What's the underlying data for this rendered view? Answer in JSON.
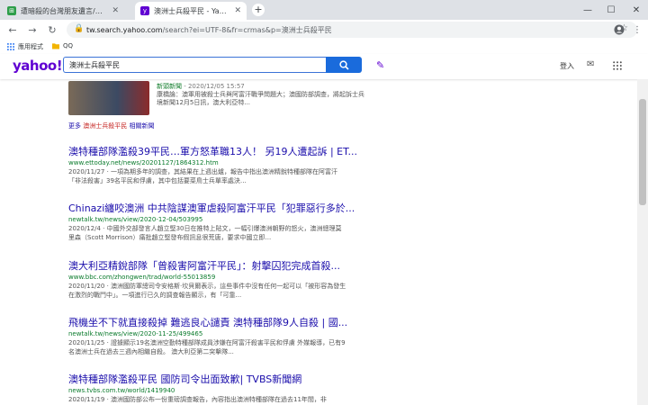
{
  "browser": {
    "tabs": [
      {
        "title": "遭暗殺的台灣朋友遺言/澳大利亞...",
        "active": false
      },
      {
        "title": "澳洲士兵殺平民 - Yahoo奇摩 搜...",
        "active": true
      }
    ],
    "new_tab": "+",
    "window_controls": [
      "—",
      "☐",
      "✕"
    ],
    "url_host": "tw.search.yahoo.com",
    "url_path": "/search?ei=UTF-8&fr=crmas&p=澳洲士兵殺平民",
    "bookmarks": [
      "應用程式",
      "QQ"
    ]
  },
  "header": {
    "logo": "yahoo!",
    "query": "澳洲士兵殺平民",
    "login": "登入"
  },
  "news": {
    "source": "新頭新聞",
    "date": " - 2020/12/05 15:57",
    "snippet1": "康橋論：澳軍用被殺士兵與阿富汗戰爭問題大；澳國防部調查，將起訴士兵",
    "snippet2": "境新聞12月5日訊，澳大利亞特..."
  },
  "more": {
    "prefix": "更多",
    "query": "澳洲士兵殺平民",
    "suffix": "相關新聞"
  },
  "results": [
    {
      "title": "澳特種部隊濫殺39平民…軍方怒革職13人！ 另19人遭起訴 | ET...",
      "url": "www.ettoday.net/news/20201127/1864312.htm",
      "s1": "2020/11/27 · 一項為期多年的調查，其結果在上週出爐，報告中指出澳洲精銳特種部隊在阿富汗",
      "s2": "「非法殺害」39名平民和俘虜，其中包括要菜鳥士兵單率處決…"
    },
    {
      "title": "Chinazi纏咬澳洲 中共陰謀澳軍虐殺阿富汗平民「犯罪惡行多於...",
      "url": "newtalk.tw/news/view/2020-12-04/503995",
      "s1": "2020/12/4 · 中國外交部發言人趙立堅30日在推特上貼文，一幅引爆澳洲朝野的怒火，澳洲總理莫",
      "s2": "里森（Scott Morrison）痛批趙立堅發布假訊息很荒唐，要求中國立即..."
    },
    {
      "title": "澳大利亞精銳部隊「曾殺害阿富汗平民」：射擊囚犯完成首殺...",
      "url": "www.bbc.com/zhongwen/trad/world-55013859",
      "s1": "2020/11/20 · 澳洲國防軍總司令安格斯·坎貝爾表示，這些事件中沒有任何一起可以「被形容為發生",
      "s2": "在激烈的戰鬥中」。一項進行已久的調查報告顯示，有「可靠..."
    },
    {
      "title": "飛機坐不下就直接殺掉 難逃良心譴責 澳特種部隊9人自殺 | 國...",
      "url": "newtalk.tw/news/view/2020-11-25/499465",
      "s1": "2020/11/25 · 證據顯示19名澳洲空勤特種部隊成員涉嫌在阿富汗殺害平民和俘虜 外媒報導，已有9",
      "s2": "名澳洲士兵在過去三週內相繼自殺。 澳大利亞第二突擊隊..."
    },
    {
      "title": "澳特種部隊濫殺平民 國防司令出面致歉| TVBS新聞網",
      "url": "news.tvbs.com.tw/world/1419940",
      "s1": "2020/11/19 · 澳洲國防部公布一份重磅調查報告，內容指出澳洲特種部隊在過去11年間，非",
      "s2": ""
    }
  ],
  "colors": {
    "accent": "#6001d2",
    "link": "#1a0dab",
    "url": "#0b7b2d",
    "search_button": "#1a6bdc"
  }
}
